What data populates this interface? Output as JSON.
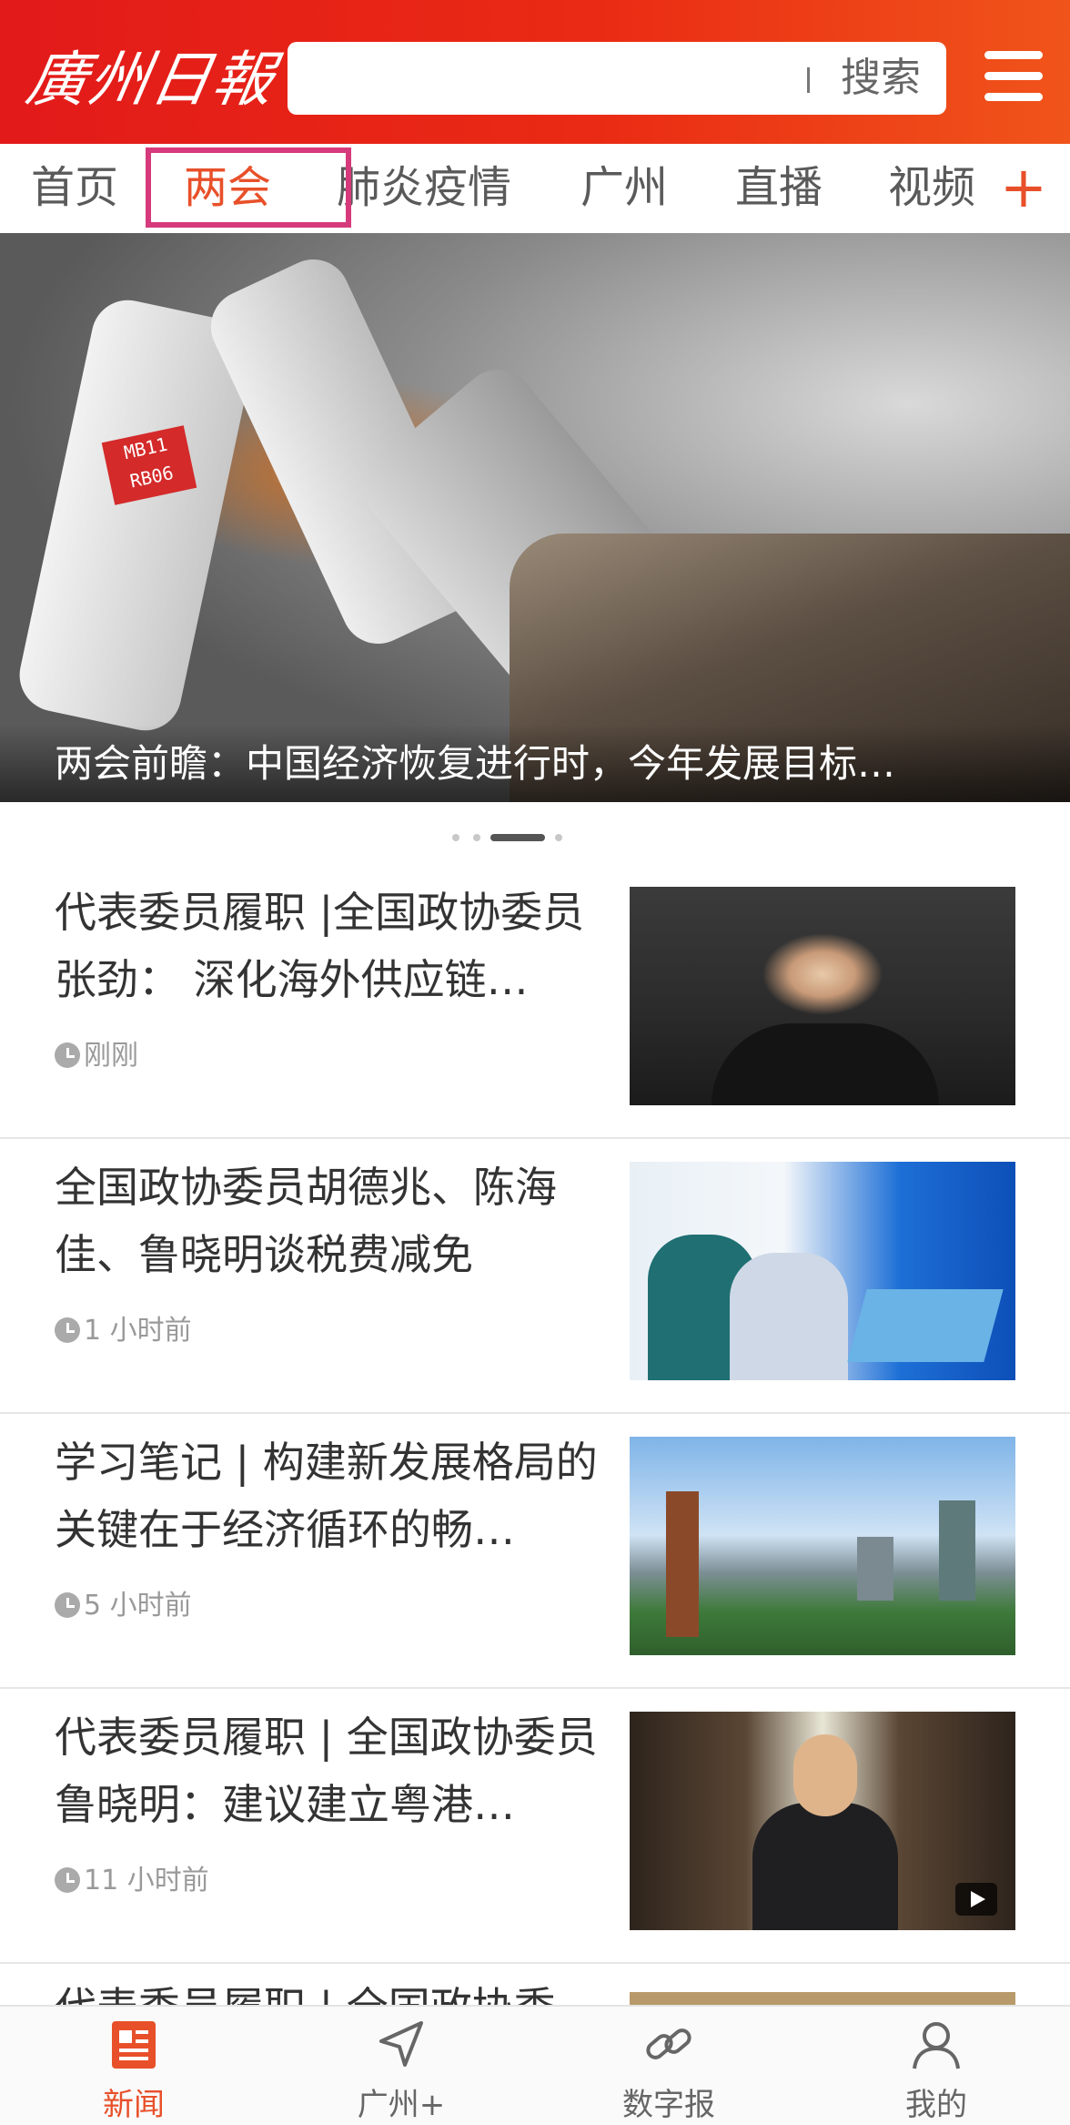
{
  "header": {
    "logo_text": "廣州日報",
    "search_label": "搜索"
  },
  "tabs": [
    {
      "label": "首页"
    },
    {
      "label": "两会",
      "active": true
    },
    {
      "label": "肺炎疫情"
    },
    {
      "label": "广州"
    },
    {
      "label": "直播"
    },
    {
      "label": "视频"
    }
  ],
  "tab_add_label": "+",
  "banner": {
    "caption": "两会前瞻：中国经济恢复进行时，今年发展目标…",
    "robot_tag": "MB11 RB06",
    "slide_count": 4,
    "active_slide": 3
  },
  "news": [
    {
      "title": "代表委员履职 |全国政协委员张劲： 深化海外供应链…",
      "time": "刚刚"
    },
    {
      "title": "全国政协委员胡德兆、陈海佳、鲁晓明谈税费减免",
      "time": "1 小时前"
    },
    {
      "title": "学习笔记 | 构建新发展格局的关键在于经济循环的畅…",
      "time": "5 小时前"
    },
    {
      "title": "代表委员履职 | 全国政协委员鲁晓明：建议建立粤港…",
      "time": "11 小时前"
    },
    {
      "title": "代表委员履职 | 全国政协委"
    }
  ],
  "bottom_nav": [
    {
      "label": "新闻",
      "active": true
    },
    {
      "label": "广州+"
    },
    {
      "label": "数字报"
    },
    {
      "label": "我的"
    }
  ],
  "colors": {
    "header_red": "#e21a1a",
    "accent_orange": "#e8502a",
    "highlight_pink": "#d63a7c"
  }
}
